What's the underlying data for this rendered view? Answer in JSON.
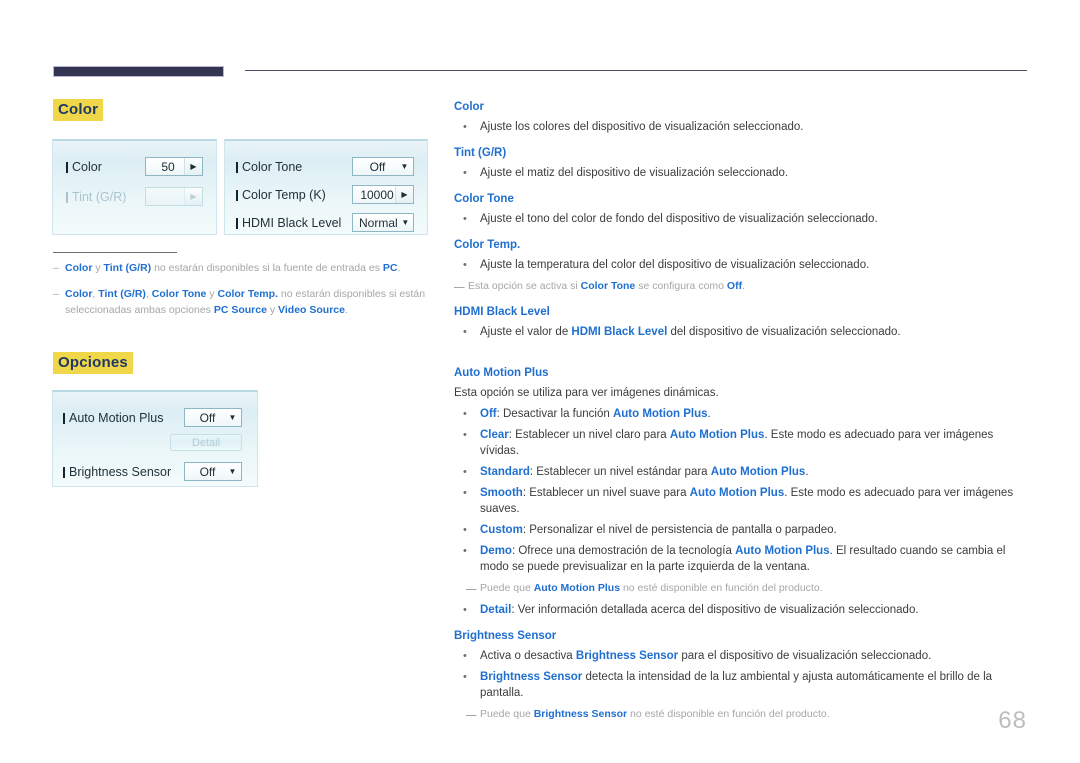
{
  "page": {
    "number": "68"
  },
  "colors": {
    "heading_highlight": "#f0d74a",
    "heading_text": "#1f3864",
    "link_blue": "#1f6fd0",
    "note_gray": "#a6a6a6",
    "rule_navy": "#333352"
  },
  "sections": {
    "color": {
      "heading": "Color"
    },
    "opciones": {
      "heading": "Opciones"
    }
  },
  "osd_color_panel": {
    "left": {
      "rows": [
        {
          "label": "Color",
          "value": "50",
          "control": "spinner",
          "disabled": false
        },
        {
          "label": "Tint (G/R)",
          "value": "",
          "control": "spinner",
          "disabled": true
        }
      ]
    },
    "right": {
      "rows": [
        {
          "label": "Color Tone",
          "value": "Off",
          "control": "dropdown",
          "disabled": false
        },
        {
          "label": "Color Temp (K)",
          "value": "10000",
          "control": "spinner",
          "disabled": false
        },
        {
          "label": "HDMI Black Level",
          "value": "Normal",
          "control": "dropdown",
          "disabled": false
        }
      ]
    }
  },
  "osd_options_panel": {
    "rows": [
      {
        "label": "Auto Motion Plus",
        "value": "Off",
        "control": "dropdown",
        "disabled": false
      },
      {
        "label": "Brightness Sensor",
        "value": "Off",
        "control": "dropdown",
        "disabled": false
      }
    ],
    "detail_button": {
      "label": "Detail",
      "disabled": true
    }
  },
  "left_notes": [
    {
      "dash": "–",
      "html": "<span class=\"nb\">Color</span> y <span class=\"nb\">Tint (G/R)</span> no estarán disponibles si la fuente de entrada es <span class=\"nb\">PC</span>."
    },
    {
      "dash": "–",
      "html": "<span class=\"nb\">Color</span>, <span class=\"nb\">Tint (G/R)</span>, <span class=\"nb\">Color Tone</span> y <span class=\"nb\">Color Temp.</span> no estarán disponibles si están seleccionadas ambas opciones <span class=\"nb\">PC Source</span> y <span class=\"nb\">Video Source</span>."
    }
  ],
  "right_column": [
    {
      "type": "head",
      "text": "Color"
    },
    {
      "type": "item",
      "bullet": "•",
      "html": "Ajuste los colores del dispositivo de visualización seleccionado."
    },
    {
      "type": "head",
      "text": "Tint (G/R)"
    },
    {
      "type": "item",
      "bullet": "•",
      "html": "Ajuste el matiz del dispositivo de visualización seleccionado."
    },
    {
      "type": "head",
      "text": "Color Tone"
    },
    {
      "type": "item",
      "bullet": "•",
      "html": "Ajuste el tono del color de fondo del dispositivo de visualización seleccionado."
    },
    {
      "type": "head",
      "text": "Color Temp."
    },
    {
      "type": "item",
      "bullet": "•",
      "html": "Ajuste la temperatura del color del dispositivo de visualización seleccionado."
    },
    {
      "type": "note",
      "indent": "less",
      "html": "Esta opción se activa si <span class=\"nb\">Color Tone</span> se configura como <span class=\"nb\">Off</span>."
    },
    {
      "type": "head",
      "text": "HDMI Black Level"
    },
    {
      "type": "item",
      "bullet": "•",
      "html": "Ajuste el valor de <span class=\"nb\">HDMI Black Level</span> del dispositivo de visualización seleccionado."
    },
    {
      "type": "head",
      "text": "Auto Motion Plus",
      "spacer_before": true
    },
    {
      "type": "plain",
      "html": "Esta opción se utiliza para ver imágenes dinámicas."
    },
    {
      "type": "item",
      "bullet": "•",
      "html": "<span class=\"nb\">Off</span>: Desactivar la función <span class=\"nb\">Auto Motion Plus</span>."
    },
    {
      "type": "item",
      "bullet": "•",
      "html": "<span class=\"nb\">Clear</span>: Establecer un nivel claro para <span class=\"nb\">Auto Motion Plus</span>. Este modo es adecuado para ver imágenes vívidas."
    },
    {
      "type": "item",
      "bullet": "•",
      "html": "<span class=\"nb\">Standard</span>: Establecer un nivel estándar para <span class=\"nb\">Auto Motion Plus</span>."
    },
    {
      "type": "item",
      "bullet": "•",
      "html": "<span class=\"nb\">Smooth</span>: Establecer un nivel suave para <span class=\"nb\">Auto Motion Plus</span>. Este modo es adecuado para ver imágenes suaves."
    },
    {
      "type": "item",
      "bullet": "•",
      "html": "<span class=\"nb\">Custom</span>: Personalizar el nivel de persistencia de pantalla o parpadeo."
    },
    {
      "type": "item",
      "bullet": "•",
      "html": "<span class=\"nb\">Demo</span>: Ofrece una demostración de la tecnología <span class=\"nb\">Auto Motion Plus</span>. El resultado cuando se cambia el modo se puede previsualizar en la parte izquierda de la ventana."
    },
    {
      "type": "note",
      "indent": "more",
      "html": "Puede que <span class=\"nb\">Auto Motion Plus</span> no esté disponible en función del producto."
    },
    {
      "type": "item",
      "bullet": "•",
      "html": "<span class=\"nb\">Detail</span>: Ver información detallada acerca del dispositivo de visualización seleccionado."
    },
    {
      "type": "head",
      "text": "Brightness Sensor"
    },
    {
      "type": "item",
      "bullet": "•",
      "html": "Activa o desactiva <span class=\"nb\">Brightness Sensor</span> para el dispositivo de visualización seleccionado."
    },
    {
      "type": "item",
      "bullet": "•",
      "html": "<span class=\"nb\">Brightness Sensor</span> detecta la intensidad de la luz ambiental y ajusta automáticamente el brillo de la pantalla."
    },
    {
      "type": "note",
      "indent": "more",
      "html": "Puede que <span class=\"nb\">Brightness Sensor</span> no esté disponible en función del producto."
    }
  ]
}
